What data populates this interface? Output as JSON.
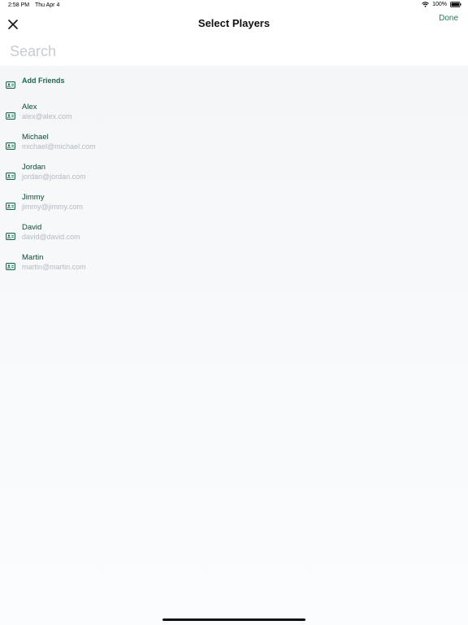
{
  "status_bar": {
    "time": "2:58 PM",
    "date": "Thu Apr 4",
    "battery": "100%"
  },
  "nav": {
    "title": "Select Players",
    "done_label": "Done"
  },
  "search": {
    "placeholder": "Search",
    "value": ""
  },
  "add_friends": {
    "label": "Add Friends",
    "icon": "contact-card-icon"
  },
  "players": [
    {
      "name": "Alex",
      "email": "alex@alex.com"
    },
    {
      "name": "Michael",
      "email": "michael@michael.com"
    },
    {
      "name": "Jordan",
      "email": "jordan@jordan.com"
    },
    {
      "name": "Jimmy",
      "email": "jimmy@jimmy.com"
    },
    {
      "name": "David",
      "email": "david@david.com"
    },
    {
      "name": "Martin",
      "email": "martin@martin.com"
    }
  ],
  "colors": {
    "accent": "#1e7a55",
    "name_text": "#114a33",
    "email_text": "#b4bac1",
    "placeholder": "#c8ccd1"
  }
}
